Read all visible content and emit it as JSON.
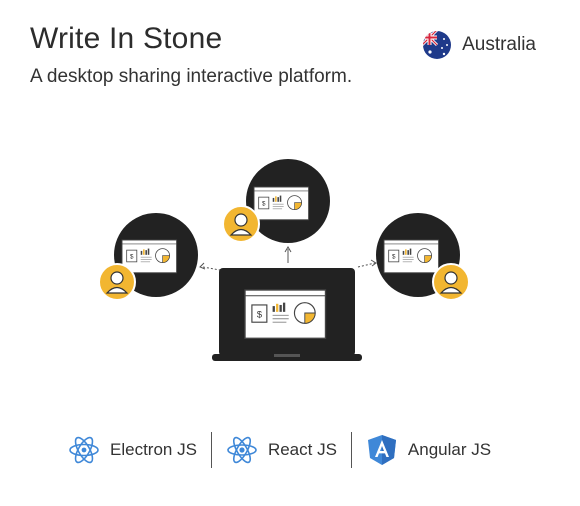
{
  "header": {
    "title": "Write In Stone",
    "subtitle": "A desktop sharing interactive platform."
  },
  "country": {
    "label": "Australia",
    "flag_icon": "australia-flag-icon"
  },
  "colors": {
    "accent": "#f2b631",
    "laptop": "#222222",
    "screen_border": "#333333",
    "framework_blue": "#3f88d8"
  },
  "technologies": [
    {
      "label": "Electron JS",
      "icon": "electron-icon"
    },
    {
      "label": "React JS",
      "icon": "react-icon"
    },
    {
      "label": "Angular JS",
      "icon": "angular-icon"
    }
  ]
}
